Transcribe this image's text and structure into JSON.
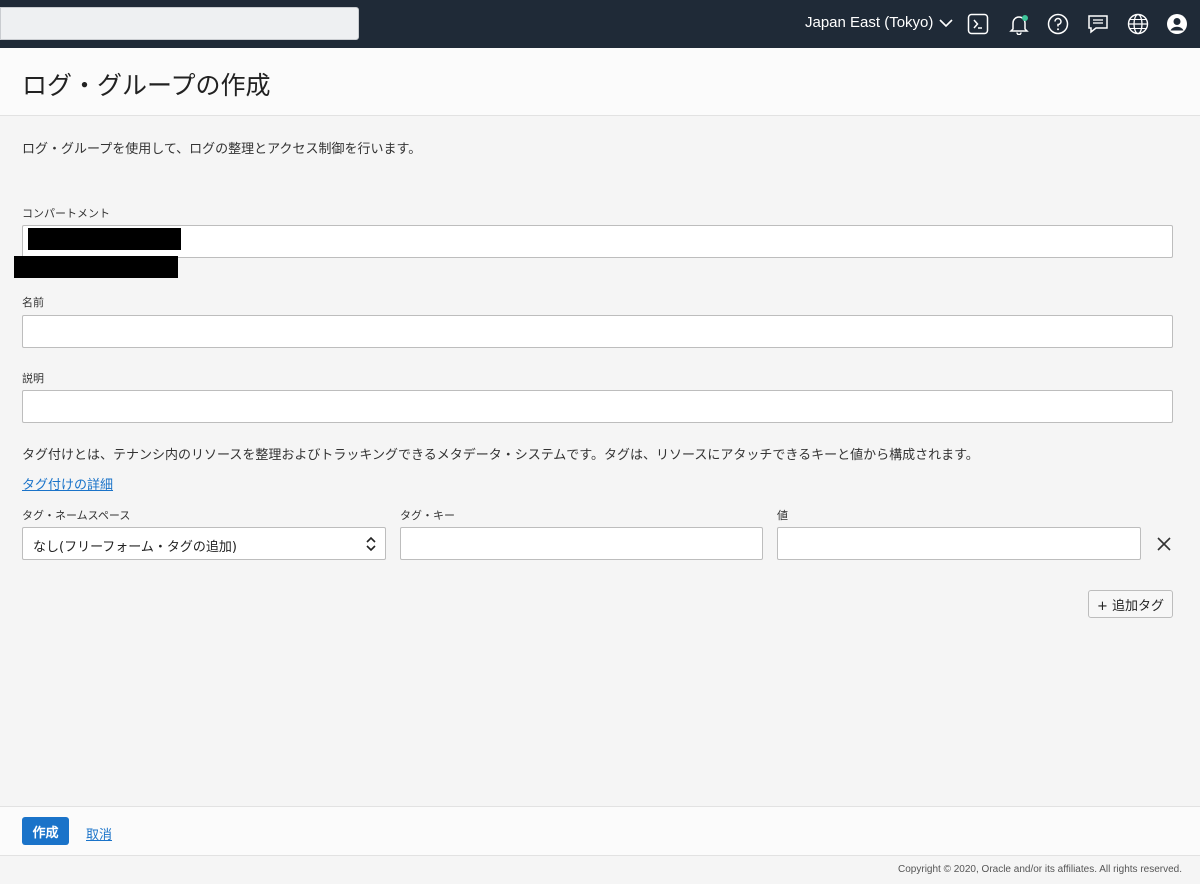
{
  "topbar": {
    "region": "Japan East (Tokyo)"
  },
  "header": {
    "title": "ログ・グループの作成"
  },
  "form": {
    "description": "ログ・グループを使用して、ログの整理とアクセス制御を行います。",
    "compartment_label": "コンパートメント",
    "name_label": "名前",
    "name_value": "",
    "desc_label": "説明",
    "desc_value": ""
  },
  "tags": {
    "info": "タグ付けとは、テナンシ内のリソースを整理およびトラッキングできるメタデータ・システムです。タグは、リソースにアタッチできるキーと値から構成されます。",
    "details_link": "タグ付けの詳細",
    "namespace_label": "タグ・ネームスペース",
    "namespace_value": "なし(フリーフォーム・タグの追加)",
    "key_label": "タグ・キー",
    "key_value": "",
    "value_label": "値",
    "value_value": "",
    "add_tag_label": "+ 追加タグ"
  },
  "footer": {
    "create_label": "作成",
    "cancel_label": "取消",
    "copyright": "Copyright © 2020, Oracle and/or its affiliates. All rights reserved."
  },
  "icons": {
    "cloud_shell": "terminal-icon",
    "notifications": "bell-icon",
    "help": "help-icon",
    "feedback": "chat-icon",
    "language": "globe-icon",
    "profile": "user-icon"
  },
  "colors": {
    "topbar": "#1f2a37",
    "primary": "#1a73c9",
    "notification_dot": "#3ec59a"
  }
}
